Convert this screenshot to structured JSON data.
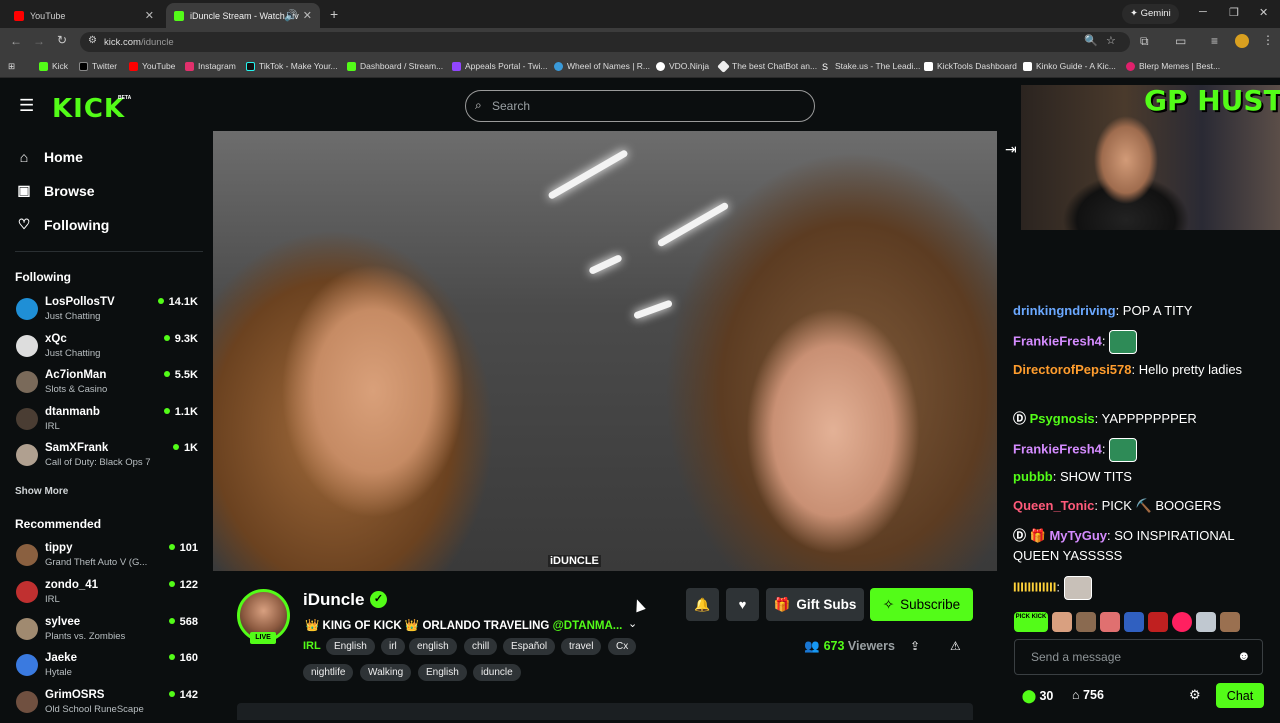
{
  "browser": {
    "tabs": [
      {
        "title": "YouTube",
        "color": "#ff0000"
      },
      {
        "title": "iDuncle Stream - Watch Liv",
        "color": "#53fc18"
      }
    ],
    "new_tab": "+",
    "gemini": "Gemini",
    "url_host": "kick.com",
    "url_path": "/iduncle",
    "bookmarks": [
      "Kick",
      "Twitter",
      "YouTube",
      "Instagram",
      "TikTok - Make Your...",
      "Dashboard / Stream...",
      "Appeals Portal - Twi...",
      "Wheel of Names | R...",
      "VDO.Ninja",
      "The best ChatBot an...",
      "Stake.us - The Leadi...",
      "KickTools Dashboard",
      "Kinko Guide - A Kic...",
      "Blerp Memes | Best..."
    ]
  },
  "header": {
    "logo": "KICK",
    "beta": "BETA",
    "search_placeholder": "Search"
  },
  "nav": {
    "home": "Home",
    "browse": "Browse",
    "following": "Following"
  },
  "sidebar": {
    "following_title": "Following",
    "following": [
      {
        "name": "LosPollosTV",
        "category": "Just Chatting",
        "viewers": "14.1K",
        "color": "#1f8fd6"
      },
      {
        "name": "xQc",
        "category": "Just Chatting",
        "viewers": "9.3K",
        "color": "#dddddd"
      },
      {
        "name": "Ac7ionMan",
        "category": "Slots & Casino",
        "viewers": "5.5K",
        "color": "#7a6a5a"
      },
      {
        "name": "dtanmanb",
        "category": "IRL",
        "viewers": "1.1K",
        "color": "#4a3d33"
      },
      {
        "name": "SamXFrank",
        "category": "Call of Duty: Black Ops 7",
        "viewers": "1K",
        "color": "#b0a090"
      }
    ],
    "show_more": "Show More",
    "recommended_title": "Recommended",
    "recommended": [
      {
        "name": "tippy",
        "category": "Grand Theft Auto V (G...",
        "viewers": "101",
        "color": "#8a6040"
      },
      {
        "name": "zondo_41",
        "category": "IRL",
        "viewers": "122",
        "color": "#c03030"
      },
      {
        "name": "sylvee",
        "category": "Plants vs. Zombies",
        "viewers": "568",
        "color": "#a08a70"
      },
      {
        "name": "Jaeke",
        "category": "Hytale",
        "viewers": "160",
        "color": "#3a7ae0"
      },
      {
        "name": "GrimOSRS",
        "category": "Old School RuneScape",
        "viewers": "142",
        "color": "#705040"
      }
    ]
  },
  "video": {
    "watermark": "iDUNCLE"
  },
  "channel": {
    "name": "iDuncle",
    "live": "LIVE",
    "title": "👑 KING OF KICK 👑 ORLANDO TRAVELING",
    "mention": "@DTANMA...",
    "category": "IRL",
    "tags_row1": [
      "English",
      "irl",
      "english",
      "chill",
      "Español",
      "travel",
      "Cx"
    ],
    "tags_row2": [
      "nightlife",
      "Walking",
      "English",
      "iduncle"
    ],
    "gift_subs": "Gift Subs",
    "subscribe": "Subscribe",
    "viewer_count": "673",
    "viewers_label": "Viewers"
  },
  "overlay": {
    "cam_text": "GP HUSTLA"
  },
  "chat": {
    "messages": [
      {
        "user": "drinkingndriving",
        "color": "#6ba8ff",
        "text": "POP A TITY"
      },
      {
        "user": "FrankieFresh4",
        "color": "#d58cff",
        "text": ""
      },
      {
        "user": "DirectorofPepsi578",
        "color": "#ff9d2e",
        "text": "Hello pretty ladies"
      },
      {
        "user": "Psygnosis",
        "color": "#53fc18",
        "text": "YAPPPPPPPER"
      },
      {
        "user": "FrankieFresh4",
        "color": "#d58cff",
        "text": ""
      },
      {
        "user": "pubbb",
        "color": "#53fc18",
        "text": "SHOW TITS"
      },
      {
        "user": "Queen_Tonic",
        "color": "#ff5a7a",
        "text": "PICK ⛏️ BOOGERS"
      },
      {
        "user": "MyTyGuy",
        "color": "#d58cff",
        "text": "SO INSPIRATIONAL QUEEN YASSSSS"
      },
      {
        "user": "IIIIIIIIIIII",
        "color": "#ffd23a",
        "text": ""
      }
    ],
    "emote_label": "PICK KICK",
    "input_placeholder": "Send a message",
    "points": "30",
    "gift_count": "756",
    "chat_button": "Chat"
  }
}
